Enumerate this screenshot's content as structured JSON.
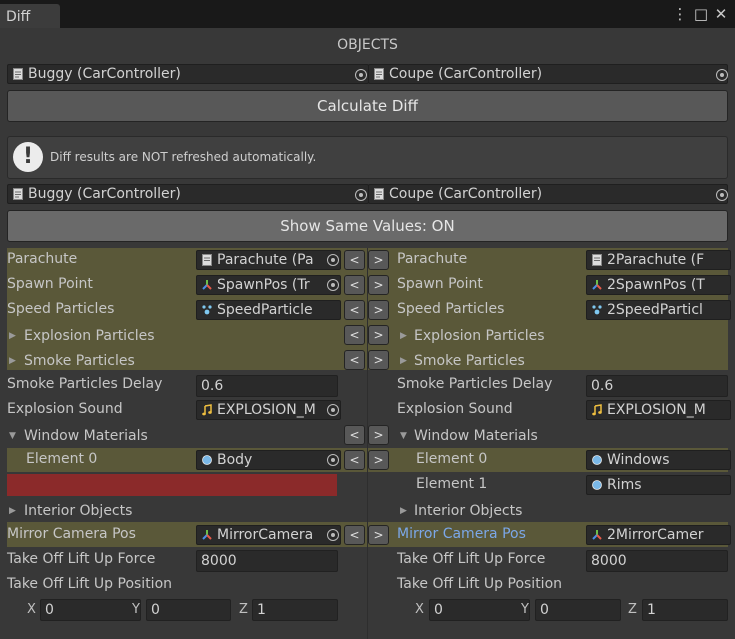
{
  "window": {
    "tab_title": "Diff"
  },
  "header": {
    "title": "OBJECTS"
  },
  "objects": {
    "left": "Buggy (CarController)",
    "right": "Coupe (CarController)"
  },
  "calculate_label": "Calculate Diff",
  "help_text": "Diff results are NOT refreshed automatically.",
  "result_objects": {
    "left": "Buggy (CarController)",
    "right": "Coupe (CarController)"
  },
  "show_same_label": "Show Same Values: ON",
  "arrows": {
    "left": "<",
    "right": ">"
  },
  "left": {
    "parachute": {
      "label": "Parachute",
      "value": "Parachute (Pa"
    },
    "spawn": {
      "label": "Spawn Point",
      "value": "SpawnPos (Tr"
    },
    "speed": {
      "label": "Speed Particles",
      "value": "SpeedParticle"
    },
    "explosion_particles": {
      "label": "Explosion Particles"
    },
    "smoke_particles": {
      "label": "Smoke Particles"
    },
    "smoke_delay": {
      "label": "Smoke Particles Delay",
      "value": "0.6"
    },
    "explosion_sound": {
      "label": "Explosion Sound",
      "value": "EXPLOSION_M"
    },
    "window_materials": {
      "label": "Window Materials"
    },
    "element0": {
      "label": "Element 0",
      "value": "Body"
    },
    "interior": {
      "label": "Interior Objects"
    },
    "mirror": {
      "label": "Mirror Camera Pos",
      "value": "MirrorCamera"
    },
    "lift_force": {
      "label": "Take Off Lift Up Force",
      "value": "8000"
    },
    "lift_pos": {
      "label": "Take Off Lift Up Position",
      "x": "0",
      "y": "0",
      "z": "1"
    }
  },
  "right": {
    "parachute": {
      "label": "Parachute",
      "value": "2Parachute (F"
    },
    "spawn": {
      "label": "Spawn Point",
      "value": "2SpawnPos (T"
    },
    "speed": {
      "label": "Speed Particles",
      "value": "2SpeedParticl"
    },
    "explosion_particles": {
      "label": "Explosion Particles"
    },
    "smoke_particles": {
      "label": "Smoke Particles"
    },
    "smoke_delay": {
      "label": "Smoke Particles Delay",
      "value": "0.6"
    },
    "explosion_sound": {
      "label": "Explosion Sound",
      "value": "EXPLOSION_M"
    },
    "window_materials": {
      "label": "Window Materials"
    },
    "element0": {
      "label": "Element 0",
      "value": "Windows"
    },
    "element1": {
      "label": "Element 1",
      "value": "Rims"
    },
    "interior": {
      "label": "Interior Objects"
    },
    "mirror": {
      "label": "Mirror Camera Pos",
      "value": "2MirrorCamer"
    },
    "lift_force": {
      "label": "Take Off Lift Up Force",
      "value": "8000"
    },
    "lift_pos": {
      "label": "Take Off Lift Up Position",
      "x": "0",
      "y": "0",
      "z": "1"
    }
  },
  "axis_labels": {
    "x": "X",
    "y": "Y",
    "z": "Z"
  },
  "colors": {
    "highlight": "#5a5839",
    "missing": "#8b2a2a",
    "changed_label": "#7ba7e8"
  }
}
